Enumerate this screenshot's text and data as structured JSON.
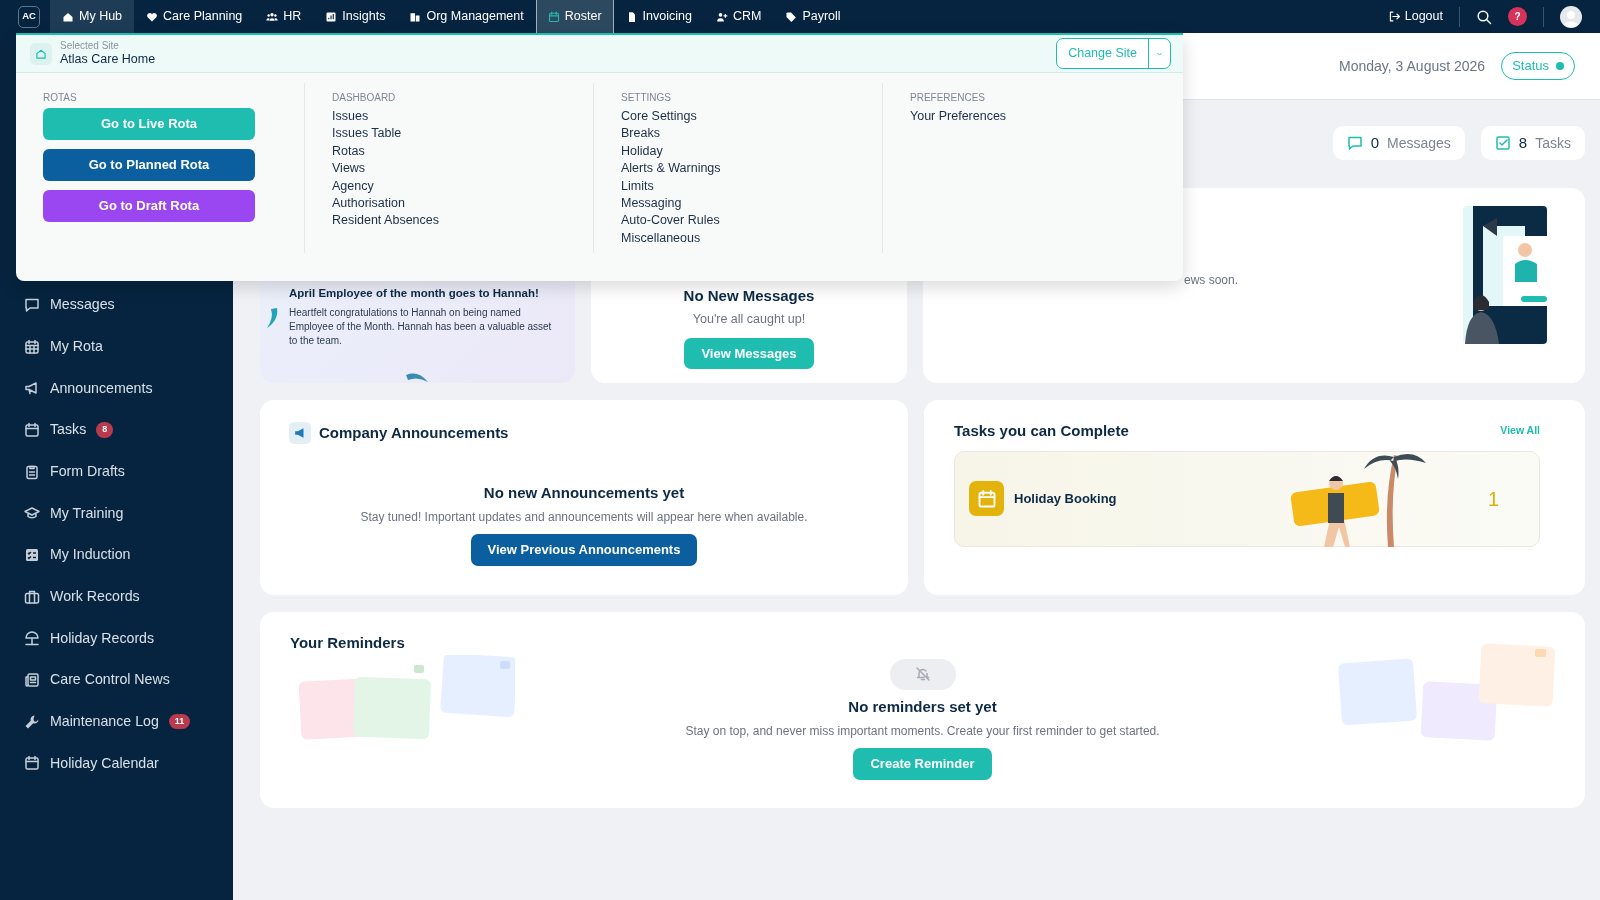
{
  "nav": {
    "logo": "AC",
    "items": [
      {
        "label": "My Hub",
        "selected": true,
        "expanded": false
      },
      {
        "label": "Care Planning",
        "selected": false,
        "expanded": false
      },
      {
        "label": "HR",
        "selected": false,
        "expanded": false
      },
      {
        "label": "Insights",
        "selected": false,
        "expanded": false
      },
      {
        "label": "Org Management",
        "selected": false,
        "expanded": false
      },
      {
        "label": "Roster",
        "selected": false,
        "expanded": true
      },
      {
        "label": "Invoicing",
        "selected": false,
        "expanded": false
      },
      {
        "label": "CRM",
        "selected": false,
        "expanded": false
      },
      {
        "label": "Payroll",
        "selected": false,
        "expanded": false
      }
    ],
    "logout": "Logout",
    "help": "?"
  },
  "header": {
    "date": "Monday, 3 August 2026",
    "status": "Status"
  },
  "site_menu": {
    "label": "Selected Site",
    "site": "Atlas Care Home",
    "change_button": "Change Site",
    "columns": [
      {
        "kind": "buttons",
        "heading": "ROTAS",
        "items": [
          {
            "label": "Go to Live Rota",
            "color": "#1fbcb0"
          },
          {
            "label": "Go to Planned Rota",
            "color": "#0b5f9e"
          },
          {
            "label": "Go to Draft Rota",
            "color": "#9a47f2"
          }
        ]
      },
      {
        "kind": "links",
        "heading": "DASHBOARD",
        "items": [
          {
            "label": "Issues"
          },
          {
            "label": "Issues Table"
          },
          {
            "label": "Rotas"
          },
          {
            "label": "Views"
          },
          {
            "label": "Agency"
          },
          {
            "label": "Authorisation"
          },
          {
            "label": "Resident Absences"
          }
        ]
      },
      {
        "kind": "links",
        "heading": "SETTINGS",
        "items": [
          {
            "label": "Core Settings"
          },
          {
            "label": "Breaks"
          },
          {
            "label": "Holiday"
          },
          {
            "label": "Alerts & Warnings"
          },
          {
            "label": "Limits"
          },
          {
            "label": "Messaging"
          },
          {
            "label": "Auto-Cover Rules"
          },
          {
            "label": "Miscellaneous"
          }
        ]
      },
      {
        "kind": "links",
        "heading": "PREFERENCES",
        "items": [
          {
            "label": "Your Preferences"
          }
        ]
      }
    ]
  },
  "sidebar": {
    "items": [
      {
        "label": "Messages"
      },
      {
        "label": "My Rota"
      },
      {
        "label": "Announcements"
      },
      {
        "label": "Tasks",
        "badge": "8"
      },
      {
        "label": "Form Drafts"
      },
      {
        "label": "My Training"
      },
      {
        "label": "My Induction"
      },
      {
        "label": "Work Records"
      },
      {
        "label": "Holiday Records"
      },
      {
        "label": "Care Control News"
      },
      {
        "label": "Maintenance Log",
        "badge": "11"
      },
      {
        "label": "Holiday Calendar"
      }
    ]
  },
  "summary": {
    "messages": {
      "count": "0",
      "label": "Messages"
    },
    "tasks": {
      "count": "8",
      "label": "Tasks"
    }
  },
  "employee_card": {
    "title": "April Employee of the month goes to Hannah!",
    "text": "Heartfelt congratulations to Hannah on being named Employee of the Month. Hannah has been a valuable asset to the team."
  },
  "messages_card": {
    "title": "No New Messages",
    "subtitle": "You're all caught up!",
    "button": "View Messages"
  },
  "news_card": {
    "text": "ews soon."
  },
  "announcements": {
    "title": "Company Announcements",
    "empty_title": "No new Announcements yet",
    "empty_text": "Stay tuned! Important updates and announcements will appear here when available.",
    "button": "View Previous Announcements"
  },
  "tasks_card": {
    "title": "Tasks you can Complete",
    "view_all": "View All",
    "tasks": [
      {
        "label": "Holiday Booking",
        "count": "1"
      }
    ]
  },
  "reminders": {
    "title": "Your Reminders",
    "empty_title": "No reminders set yet",
    "empty_text": "Stay on top, and never miss important moments. Create your first reminder to get started.",
    "button": "Create Reminder"
  }
}
